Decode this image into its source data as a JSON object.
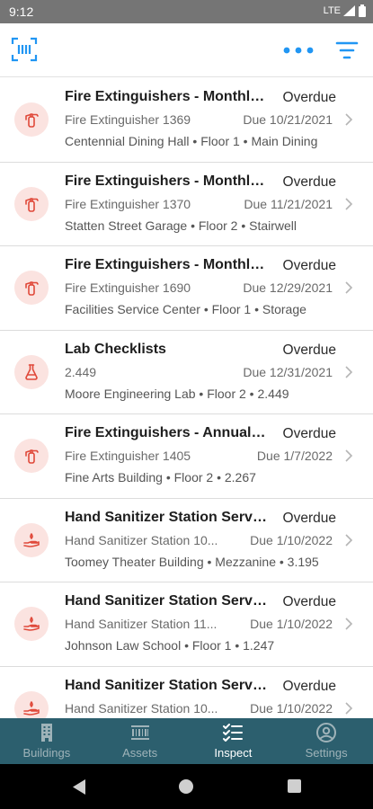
{
  "status_bar": {
    "time": "9:12",
    "network": "LTE"
  },
  "colors": {
    "accent": "#2196f3",
    "icon_red": "#e0493a",
    "icon_bg": "#fbe3e0",
    "nav_bg": "#2c5f6e"
  },
  "header": {
    "scan_icon": "barcode-scan-icon",
    "more_icon": "more-horizontal-icon",
    "filter_icon": "filter-icon"
  },
  "inspections": [
    {
      "title": "Fire Extinguishers - Monthly Inspection",
      "status": "Overdue",
      "asset": "Fire Extinguisher 1369",
      "due": "Due 10/21/2021",
      "location": "Centennial Dining Hall • Floor 1 • Main Dining",
      "icon": "fire-extinguisher-icon"
    },
    {
      "title": "Fire Extinguishers - Monthly Inspection",
      "status": "Overdue",
      "asset": "Fire Extinguisher 1370",
      "due": "Due 11/21/2021",
      "location": "Statten Street Garage • Floor 2 • Stairwell",
      "icon": "fire-extinguisher-icon"
    },
    {
      "title": "Fire Extinguishers - Monthly Inspection",
      "status": "Overdue",
      "asset": "Fire Extinguisher 1690",
      "due": "Due 12/29/2021",
      "location": "Facilities Service Center • Floor 1 • Storage",
      "icon": "fire-extinguisher-icon"
    },
    {
      "title": "Lab Checklists",
      "status": "Overdue",
      "asset": "2.449",
      "due": "Due 12/31/2021",
      "location": "Moore Engineering Lab • Floor 2 • 2.449",
      "icon": "flask-icon"
    },
    {
      "title": "Fire Extinguishers - Annual Maintenance",
      "status": "Overdue",
      "asset": "Fire Extinguisher 1405",
      "due": "Due 1/7/2022",
      "location": "Fine Arts Building • Floor 2 • 2.267",
      "icon": "fire-extinguisher-icon"
    },
    {
      "title": "Hand Sanitizer Station Service",
      "status": "Overdue",
      "asset": "Hand Sanitizer Station 10...",
      "due": "Due 1/10/2022",
      "location": "Toomey Theater Building • Mezzanine • 3.195",
      "icon": "hand-sanitizer-icon"
    },
    {
      "title": "Hand Sanitizer Station Service",
      "status": "Overdue",
      "asset": "Hand Sanitizer Station 11...",
      "due": "Due 1/10/2022",
      "location": "Johnson Law School • Floor 1 • 1.247",
      "icon": "hand-sanitizer-icon"
    },
    {
      "title": "Hand Sanitizer Station Service",
      "status": "Overdue",
      "asset": "Hand Sanitizer Station 10...",
      "due": "Due 1/10/2022",
      "location": "",
      "icon": "hand-sanitizer-icon"
    }
  ],
  "bottom_nav": [
    {
      "label": "Buildings",
      "icon": "building-icon",
      "active": false
    },
    {
      "label": "Assets",
      "icon": "barcode-icon",
      "active": false
    },
    {
      "label": "Inspect",
      "icon": "checklist-icon",
      "active": true
    },
    {
      "label": "Settings",
      "icon": "account-circle-icon",
      "active": false
    }
  ]
}
